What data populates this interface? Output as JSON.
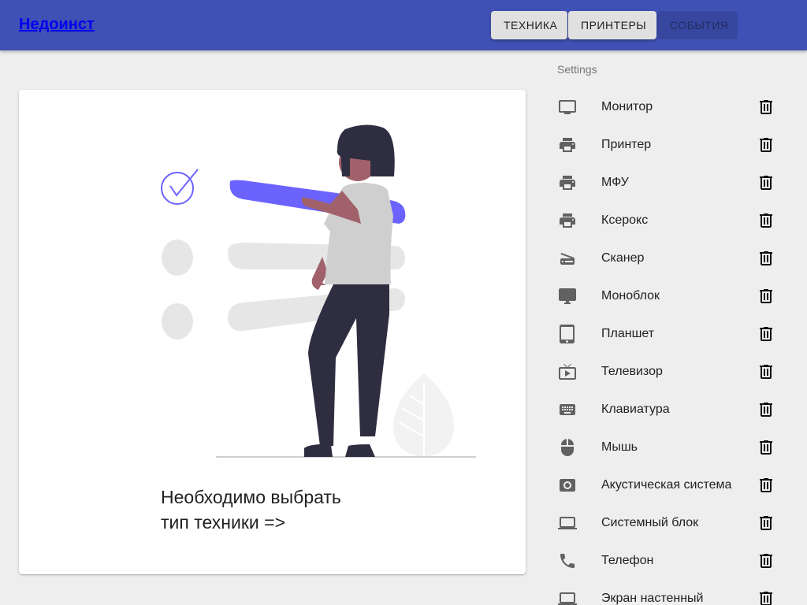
{
  "header": {
    "brand": "Недоинст",
    "nav": [
      {
        "label": "ТЕХНИКА"
      },
      {
        "label": "ПРИНТЕРЫ"
      },
      {
        "label": "СОБЫТИЯ"
      }
    ]
  },
  "main": {
    "hint": "Необходимо выбрать\nтип техники =>"
  },
  "sidebar": {
    "title": "Settings",
    "items": [
      {
        "label": "Монитор",
        "icon": "monitor-icon"
      },
      {
        "label": "Принтер",
        "icon": "printer-icon"
      },
      {
        "label": "МФУ",
        "icon": "printer-icon"
      },
      {
        "label": "Ксерокс",
        "icon": "printer-icon"
      },
      {
        "label": "Сканер",
        "icon": "scanner-icon"
      },
      {
        "label": "Моноблок",
        "icon": "desktop-icon"
      },
      {
        "label": "Планшет",
        "icon": "tablet-icon"
      },
      {
        "label": "Телевизор",
        "icon": "tv-icon"
      },
      {
        "label": "Клавиатура",
        "icon": "keyboard-icon"
      },
      {
        "label": "Мышь",
        "icon": "mouse-icon"
      },
      {
        "label": "Акустическая система",
        "icon": "speaker-icon"
      },
      {
        "label": "Системный блок",
        "icon": "laptop-icon"
      },
      {
        "label": "Телефон",
        "icon": "phone-icon"
      },
      {
        "label": "Экран настенный",
        "icon": "laptop-icon"
      }
    ]
  },
  "colors": {
    "appbar": "#3f51b5",
    "accent": "#6c63ff"
  }
}
